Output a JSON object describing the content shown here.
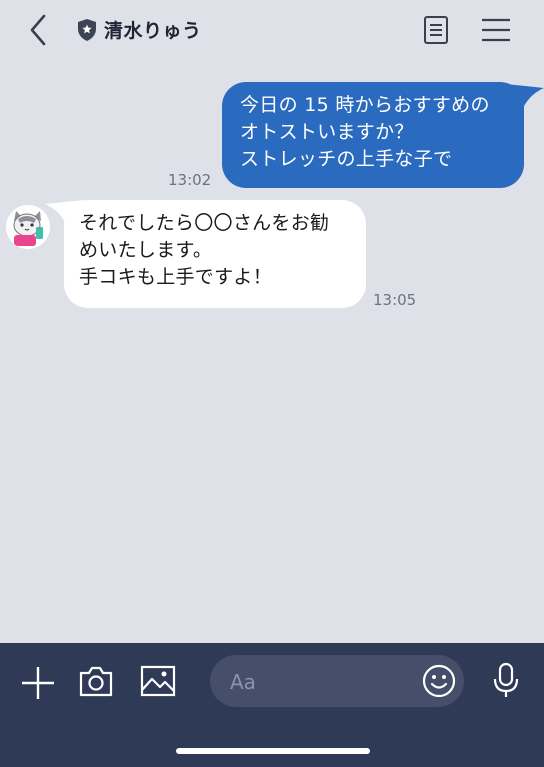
{
  "header": {
    "title": "清水りゅう"
  },
  "messages": [
    {
      "direction": "outgoing",
      "lines": [
        "今日の 15 時からおすすめの",
        "オトストいますか？",
        "ストレッチの上手な子で"
      ],
      "time": "13:02"
    },
    {
      "direction": "incoming",
      "lines": [
        "それでしたら〇〇さんをお勧",
        "めいたします。",
        "手コキも上手ですよ！"
      ],
      "time": "13:05"
    }
  ],
  "composer": {
    "placeholder": "Aa"
  },
  "colors": {
    "background": "#dfe1e8",
    "outgoing_bubble": "#2b6bbf",
    "incoming_bubble": "#ffffff",
    "bottom_bar": "#2f3a56"
  },
  "icons": [
    "back-arrow-icon",
    "shield-icon",
    "notes-icon",
    "menu-icon",
    "plus-icon",
    "camera-icon",
    "image-icon",
    "emoji-icon",
    "mic-icon"
  ]
}
